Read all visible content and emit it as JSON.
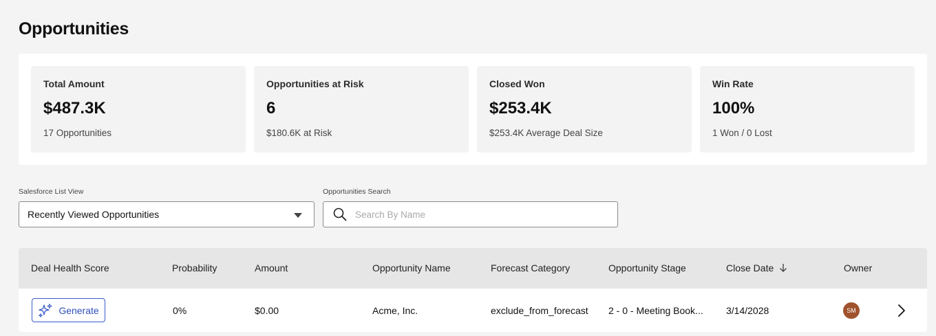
{
  "page": {
    "title": "Opportunities"
  },
  "metrics": [
    {
      "label": "Total Amount",
      "value": "$487.3K",
      "sub": "17 Opportunities"
    },
    {
      "label": "Opportunities at Risk",
      "value": "6",
      "sub": "$180.6K at Risk"
    },
    {
      "label": "Closed Won",
      "value": "$253.4K",
      "sub": "$253.4K Average Deal Size"
    },
    {
      "label": "Win Rate",
      "value": "100%",
      "sub": "1 Won / 0 Lost"
    }
  ],
  "filters": {
    "list_view_label": "Salesforce List View",
    "list_view_value": "Recently Viewed Opportunities",
    "search_label": "Opportunities Search",
    "search_placeholder": "Search By Name",
    "search_value": ""
  },
  "table": {
    "columns": [
      "Deal Health Score",
      "Probability",
      "Amount",
      "Opportunity Name",
      "Forecast Category",
      "Opportunity Stage",
      "Close Date",
      "Owner"
    ],
    "sort_icon": "arrow-down-icon",
    "rows": [
      {
        "action_label": "Generate",
        "probability": "0%",
        "amount": "$0.00",
        "name": "Acme, Inc.",
        "forecast": "exclude_from_forecast",
        "stage": "2 - 0 - Meeting Book...",
        "close_date": "3/14/2028",
        "owner_initials": "SM"
      }
    ]
  },
  "colors": {
    "accent": "#2f50b8",
    "avatar": "#a0522d",
    "background": "#f4f4f4"
  }
}
